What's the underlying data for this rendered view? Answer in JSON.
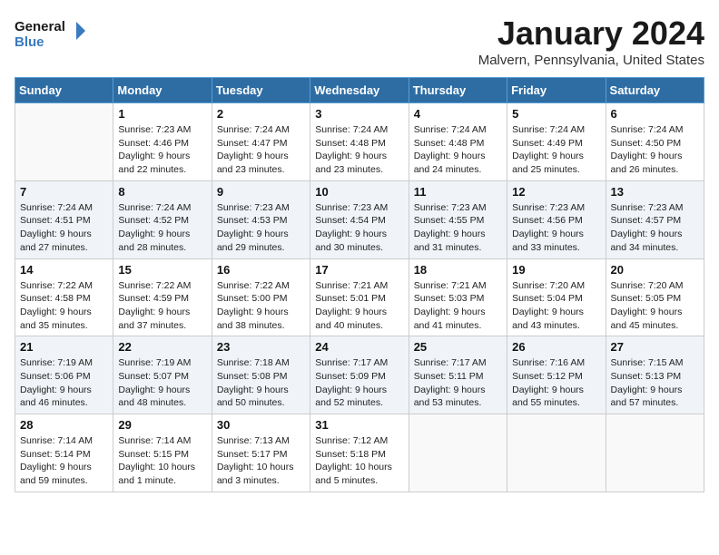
{
  "header": {
    "logo_line1": "General",
    "logo_line2": "Blue",
    "month": "January 2024",
    "location": "Malvern, Pennsylvania, United States"
  },
  "weekdays": [
    "Sunday",
    "Monday",
    "Tuesday",
    "Wednesday",
    "Thursday",
    "Friday",
    "Saturday"
  ],
  "weeks": [
    [
      {
        "day": "",
        "sunrise": "",
        "sunset": "",
        "daylight": ""
      },
      {
        "day": "1",
        "sunrise": "Sunrise: 7:23 AM",
        "sunset": "Sunset: 4:46 PM",
        "daylight": "Daylight: 9 hours and 22 minutes."
      },
      {
        "day": "2",
        "sunrise": "Sunrise: 7:24 AM",
        "sunset": "Sunset: 4:47 PM",
        "daylight": "Daylight: 9 hours and 23 minutes."
      },
      {
        "day": "3",
        "sunrise": "Sunrise: 7:24 AM",
        "sunset": "Sunset: 4:48 PM",
        "daylight": "Daylight: 9 hours and 23 minutes."
      },
      {
        "day": "4",
        "sunrise": "Sunrise: 7:24 AM",
        "sunset": "Sunset: 4:48 PM",
        "daylight": "Daylight: 9 hours and 24 minutes."
      },
      {
        "day": "5",
        "sunrise": "Sunrise: 7:24 AM",
        "sunset": "Sunset: 4:49 PM",
        "daylight": "Daylight: 9 hours and 25 minutes."
      },
      {
        "day": "6",
        "sunrise": "Sunrise: 7:24 AM",
        "sunset": "Sunset: 4:50 PM",
        "daylight": "Daylight: 9 hours and 26 minutes."
      }
    ],
    [
      {
        "day": "7",
        "sunrise": "Sunrise: 7:24 AM",
        "sunset": "Sunset: 4:51 PM",
        "daylight": "Daylight: 9 hours and 27 minutes."
      },
      {
        "day": "8",
        "sunrise": "Sunrise: 7:24 AM",
        "sunset": "Sunset: 4:52 PM",
        "daylight": "Daylight: 9 hours and 28 minutes."
      },
      {
        "day": "9",
        "sunrise": "Sunrise: 7:23 AM",
        "sunset": "Sunset: 4:53 PM",
        "daylight": "Daylight: 9 hours and 29 minutes."
      },
      {
        "day": "10",
        "sunrise": "Sunrise: 7:23 AM",
        "sunset": "Sunset: 4:54 PM",
        "daylight": "Daylight: 9 hours and 30 minutes."
      },
      {
        "day": "11",
        "sunrise": "Sunrise: 7:23 AM",
        "sunset": "Sunset: 4:55 PM",
        "daylight": "Daylight: 9 hours and 31 minutes."
      },
      {
        "day": "12",
        "sunrise": "Sunrise: 7:23 AM",
        "sunset": "Sunset: 4:56 PM",
        "daylight": "Daylight: 9 hours and 33 minutes."
      },
      {
        "day": "13",
        "sunrise": "Sunrise: 7:23 AM",
        "sunset": "Sunset: 4:57 PM",
        "daylight": "Daylight: 9 hours and 34 minutes."
      }
    ],
    [
      {
        "day": "14",
        "sunrise": "Sunrise: 7:22 AM",
        "sunset": "Sunset: 4:58 PM",
        "daylight": "Daylight: 9 hours and 35 minutes."
      },
      {
        "day": "15",
        "sunrise": "Sunrise: 7:22 AM",
        "sunset": "Sunset: 4:59 PM",
        "daylight": "Daylight: 9 hours and 37 minutes."
      },
      {
        "day": "16",
        "sunrise": "Sunrise: 7:22 AM",
        "sunset": "Sunset: 5:00 PM",
        "daylight": "Daylight: 9 hours and 38 minutes."
      },
      {
        "day": "17",
        "sunrise": "Sunrise: 7:21 AM",
        "sunset": "Sunset: 5:01 PM",
        "daylight": "Daylight: 9 hours and 40 minutes."
      },
      {
        "day": "18",
        "sunrise": "Sunrise: 7:21 AM",
        "sunset": "Sunset: 5:03 PM",
        "daylight": "Daylight: 9 hours and 41 minutes."
      },
      {
        "day": "19",
        "sunrise": "Sunrise: 7:20 AM",
        "sunset": "Sunset: 5:04 PM",
        "daylight": "Daylight: 9 hours and 43 minutes."
      },
      {
        "day": "20",
        "sunrise": "Sunrise: 7:20 AM",
        "sunset": "Sunset: 5:05 PM",
        "daylight": "Daylight: 9 hours and 45 minutes."
      }
    ],
    [
      {
        "day": "21",
        "sunrise": "Sunrise: 7:19 AM",
        "sunset": "Sunset: 5:06 PM",
        "daylight": "Daylight: 9 hours and 46 minutes."
      },
      {
        "day": "22",
        "sunrise": "Sunrise: 7:19 AM",
        "sunset": "Sunset: 5:07 PM",
        "daylight": "Daylight: 9 hours and 48 minutes."
      },
      {
        "day": "23",
        "sunrise": "Sunrise: 7:18 AM",
        "sunset": "Sunset: 5:08 PM",
        "daylight": "Daylight: 9 hours and 50 minutes."
      },
      {
        "day": "24",
        "sunrise": "Sunrise: 7:17 AM",
        "sunset": "Sunset: 5:09 PM",
        "daylight": "Daylight: 9 hours and 52 minutes."
      },
      {
        "day": "25",
        "sunrise": "Sunrise: 7:17 AM",
        "sunset": "Sunset: 5:11 PM",
        "daylight": "Daylight: 9 hours and 53 minutes."
      },
      {
        "day": "26",
        "sunrise": "Sunrise: 7:16 AM",
        "sunset": "Sunset: 5:12 PM",
        "daylight": "Daylight: 9 hours and 55 minutes."
      },
      {
        "day": "27",
        "sunrise": "Sunrise: 7:15 AM",
        "sunset": "Sunset: 5:13 PM",
        "daylight": "Daylight: 9 hours and 57 minutes."
      }
    ],
    [
      {
        "day": "28",
        "sunrise": "Sunrise: 7:14 AM",
        "sunset": "Sunset: 5:14 PM",
        "daylight": "Daylight: 9 hours and 59 minutes."
      },
      {
        "day": "29",
        "sunrise": "Sunrise: 7:14 AM",
        "sunset": "Sunset: 5:15 PM",
        "daylight": "Daylight: 10 hours and 1 minute."
      },
      {
        "day": "30",
        "sunrise": "Sunrise: 7:13 AM",
        "sunset": "Sunset: 5:17 PM",
        "daylight": "Daylight: 10 hours and 3 minutes."
      },
      {
        "day": "31",
        "sunrise": "Sunrise: 7:12 AM",
        "sunset": "Sunset: 5:18 PM",
        "daylight": "Daylight: 10 hours and 5 minutes."
      },
      {
        "day": "",
        "sunrise": "",
        "sunset": "",
        "daylight": ""
      },
      {
        "day": "",
        "sunrise": "",
        "sunset": "",
        "daylight": ""
      },
      {
        "day": "",
        "sunrise": "",
        "sunset": "",
        "daylight": ""
      }
    ]
  ]
}
